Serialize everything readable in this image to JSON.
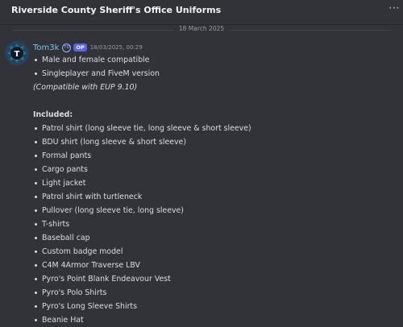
{
  "header": {
    "title": "Riverside County Sheriff's Office Uniforms",
    "more_icon": "⋯"
  },
  "date_divider": "18 March 2025",
  "message": {
    "author": "Tom3k",
    "tag_icon": "TD",
    "op_badge": "OP",
    "timestamp": "18/03/2025, 00:29",
    "intro_bullets": [
      "Male and female compatible",
      "Singleplayer and FiveM version"
    ],
    "compat_note": "(Compatible with EUP 9.10)",
    "included_heading": "Included:",
    "included_items": [
      "Patrol shirt (long sleeve tie, long sleeve & short sleeve)",
      "BDU shirt (long sleeve & short sleeve)",
      "Formal pants",
      "Cargo pants",
      "Light jacket",
      "Patrol shirt with turtleneck",
      "Pullover (long sleeve tie, long sleeve)",
      "T-shirts",
      "Baseball cap",
      "Custom badge model",
      "C4M 4Armor Traverse LBV",
      "Pyro's Point Blank Endeavour Vest",
      "Pyro's Polo Shirts",
      "Pyro's Long Sleeve Shirts",
      "Beanie Hat"
    ]
  }
}
